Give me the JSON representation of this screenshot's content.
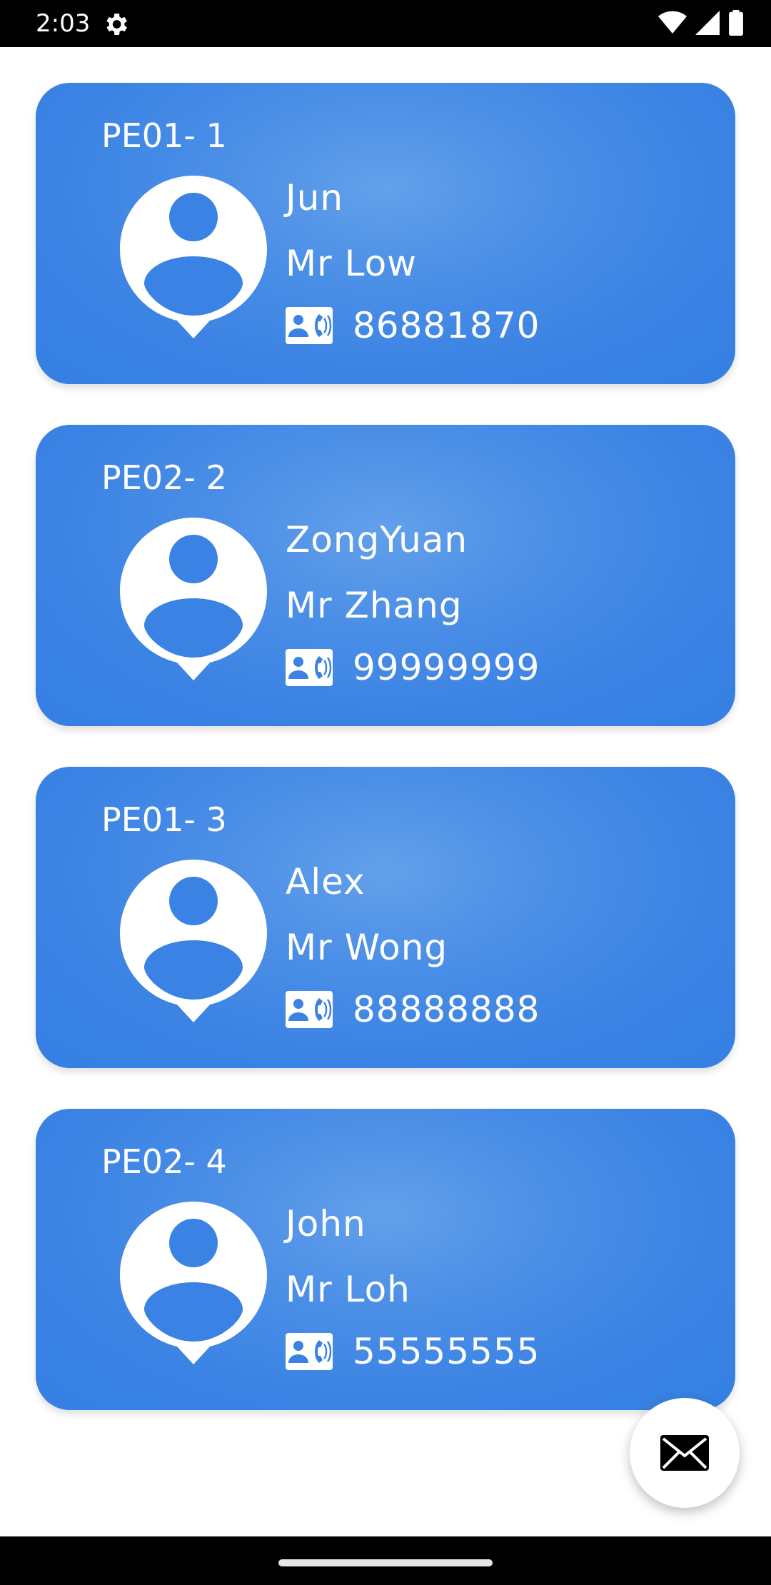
{
  "status_bar": {
    "time": "2:03",
    "icons": [
      "settings-gear-icon",
      "wifi-icon",
      "signal-icon",
      "battery-icon"
    ]
  },
  "colors": {
    "card_blue": "#3580e3",
    "card_highlight": "#62a0ea",
    "text_white": "#ffffff",
    "background": "#ffffff"
  },
  "cards": [
    {
      "code": "PE01- 1",
      "name": "Jun",
      "contact": "Mr Low",
      "phone": "86881870",
      "icon": "person-pin-icon",
      "phone_icon": "contact-phone-icon"
    },
    {
      "code": "PE02- 2",
      "name": "ZongYuan",
      "contact": "Mr Zhang",
      "phone": "99999999",
      "icon": "person-pin-icon",
      "phone_icon": "contact-phone-icon"
    },
    {
      "code": "PE01- 3",
      "name": "Alex",
      "contact": "Mr Wong",
      "phone": "88888888",
      "icon": "person-pin-icon",
      "phone_icon": "contact-phone-icon"
    },
    {
      "code": "PE02- 4",
      "name": "John",
      "contact": "Mr Loh",
      "phone": "55555555",
      "icon": "person-pin-icon",
      "phone_icon": "contact-phone-icon"
    }
  ],
  "fab": {
    "icon": "mail-envelope-icon"
  }
}
